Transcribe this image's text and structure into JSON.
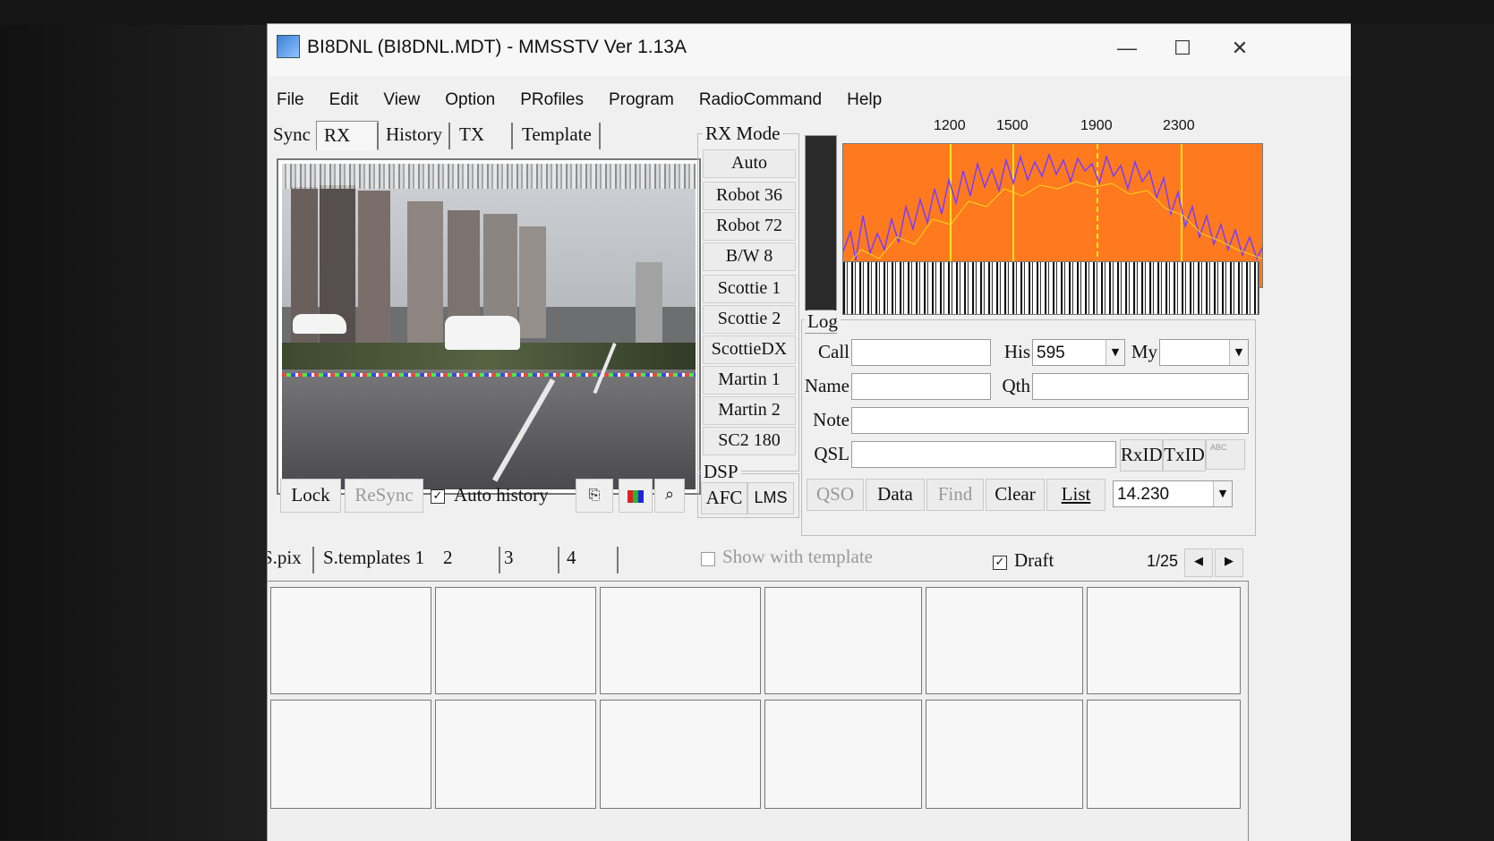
{
  "window": {
    "title": "BI8DNL (BI8DNL.MDT) - MMSSTV Ver 1.13A",
    "controls": {
      "minimize": "—",
      "maximize": "☐",
      "close": "✕"
    }
  },
  "menu": [
    "File",
    "Edit",
    "View",
    "Option",
    "PRofiles",
    "Program",
    "RadioCommand",
    "Help"
  ],
  "tabs": [
    "Sync",
    "RX",
    "History",
    "TX",
    "Template"
  ],
  "selected_tab": "RX",
  "rx_controls": {
    "lock": "Lock",
    "resync": "ReSync",
    "auto_history": "Auto history",
    "auto_history_checked": true
  },
  "rx_mode": {
    "title": "RX Mode",
    "modes": [
      "Auto",
      "Robot 36",
      "Robot 72",
      "B/W 8",
      "Scottie 1",
      "Scottie 2",
      "ScottieDX",
      "Martin 1",
      "Martin 2",
      "SC2 180"
    ]
  },
  "dsp": {
    "title": "DSP",
    "afc": "AFC",
    "lms": "LMS"
  },
  "spectrum": {
    "freq_labels": [
      "1200",
      "1500",
      "1900",
      "2300"
    ],
    "background_color": "#ff7a1f",
    "marker_color": "#f5e61a",
    "trace_color": "#7a3cff"
  },
  "log": {
    "title": "Log",
    "call_label": "Call",
    "call_value": "",
    "his_label": "His",
    "his_value": "595",
    "my_label": "My",
    "my_value": "",
    "name_label": "Name",
    "name_value": "",
    "qth_label": "Qth",
    "qth_value": "",
    "note_label": "Note",
    "note_value": "",
    "qsl_label": "QSL",
    "qsl_value": "",
    "rxid": "RxID",
    "txid": "TxID",
    "abc": "ABC",
    "buttons": [
      "QSO",
      "Data",
      "Find",
      "Clear",
      "List"
    ],
    "frequency": "14.230"
  },
  "bottom_tabs": {
    "spix": "S.pix",
    "stemplates": "S.templates 1",
    "t2": "2",
    "t3": "3",
    "t4": "4",
    "show_with_template": "Show with template",
    "show_with_template_checked": false,
    "draft": "Draft",
    "draft_checked": true,
    "page": "1/25"
  }
}
